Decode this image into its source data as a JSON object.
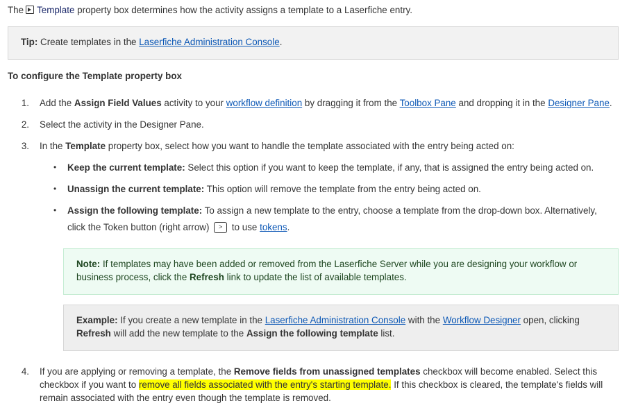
{
  "intro": {
    "prefix": "The",
    "icon": "template-icon",
    "template_word": "Template",
    "suffix": "property box determines how the activity assigns a template to a Laserfiche entry."
  },
  "tip": {
    "label": "Tip:",
    "text": "Create templates in the",
    "link": "Laserfiche Administration Console",
    "end": "."
  },
  "heading": "To configure the Template property box",
  "steps": [
    {
      "number": "1.",
      "parts": [
        "Add the",
        "Assign Field Values",
        "activity to your",
        "workflow definition",
        "by dragging it from the",
        "Toolbox Pane",
        "and dropping it in the",
        "Designer Pane",
        "."
      ]
    },
    {
      "number": "2.",
      "text": "Select the activity in the Designer Pane."
    },
    {
      "number": "3.",
      "parts": [
        "In the",
        "Template",
        "property box, select how you want to handle the template associated with the entry being acted on:"
      ],
      "bullets": [
        {
          "bold": "Keep the current template:",
          "text": "Select this option if you want to keep the template, if any, that is assigned the entry being acted on."
        },
        {
          "bold": "Unassign the current template:",
          "text": "This option will remove the template from the entry being acted on."
        },
        {
          "bold": "Assign the following template:",
          "text": "To assign a new template to the entry, choose a template from the drop-down box. Alternatively,",
          "line2_prefix": "click the Token button (right arrow)",
          "token_icon": ">",
          "line2_mid": "to use",
          "link": "tokens",
          "end": "."
        }
      ]
    },
    {
      "number": "4.",
      "line1_prefix": "If you are applying or removing a template, the",
      "line1_bold": "Remove fields from unassigned templates",
      "line1_suffix": "checkbox will become enabled. Select this",
      "line2_prefix": "checkbox if you want to",
      "line2_highlight": "remove all fields associated with the entry's starting template.",
      "line2_suffix": "If this checkbox is cleared, the template's fields will",
      "line3": "remain associated with the entry even though the template is removed.",
      "highlight_color": "#ffff00"
    }
  ],
  "note": {
    "label": "Note:",
    "line1": "If templates may have been added or removed from the Laserfiche Server while you are designing your workflow or",
    "line2_prefix": "business process, click the",
    "line2_bold": "Refresh",
    "line2_suffix": "link to update the list of available templates."
  },
  "example": {
    "label": "Example:",
    "line1_prefix": "If you create a new template in the",
    "link1": "Laserfiche Administration Console",
    "line1_mid": "with the",
    "link2": "Workflow Designer",
    "line1_suffix": "open, clicking",
    "line2_bold1": "Refresh",
    "line2_mid": "will add the new template to the",
    "line2_bold2": "Assign the following template",
    "line2_suffix": "list."
  },
  "colors": {
    "link": "#0b57b5",
    "text": "#333333",
    "tip_bg": "#f2f2f2",
    "note_bg": "#eefbf3",
    "note_text": "#1e4620",
    "example_bg": "#eeeeee",
    "highlight": "#ffff00"
  }
}
